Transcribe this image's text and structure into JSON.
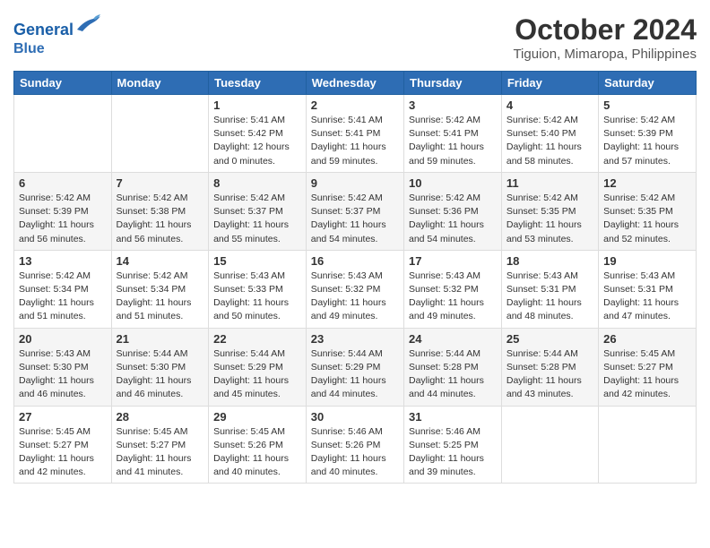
{
  "header": {
    "logo_line1": "General",
    "logo_line2": "Blue",
    "title": "October 2024",
    "subtitle": "Tiguion, Mimaropa, Philippines"
  },
  "weekdays": [
    "Sunday",
    "Monday",
    "Tuesday",
    "Wednesday",
    "Thursday",
    "Friday",
    "Saturday"
  ],
  "weeks": [
    [
      {
        "day": "",
        "info": ""
      },
      {
        "day": "",
        "info": ""
      },
      {
        "day": "1",
        "sunrise": "Sunrise: 5:41 AM",
        "sunset": "Sunset: 5:42 PM",
        "daylight": "Daylight: 12 hours and 0 minutes."
      },
      {
        "day": "2",
        "sunrise": "Sunrise: 5:41 AM",
        "sunset": "Sunset: 5:41 PM",
        "daylight": "Daylight: 11 hours and 59 minutes."
      },
      {
        "day": "3",
        "sunrise": "Sunrise: 5:42 AM",
        "sunset": "Sunset: 5:41 PM",
        "daylight": "Daylight: 11 hours and 59 minutes."
      },
      {
        "day": "4",
        "sunrise": "Sunrise: 5:42 AM",
        "sunset": "Sunset: 5:40 PM",
        "daylight": "Daylight: 11 hours and 58 minutes."
      },
      {
        "day": "5",
        "sunrise": "Sunrise: 5:42 AM",
        "sunset": "Sunset: 5:39 PM",
        "daylight": "Daylight: 11 hours and 57 minutes."
      }
    ],
    [
      {
        "day": "6",
        "sunrise": "Sunrise: 5:42 AM",
        "sunset": "Sunset: 5:39 PM",
        "daylight": "Daylight: 11 hours and 56 minutes."
      },
      {
        "day": "7",
        "sunrise": "Sunrise: 5:42 AM",
        "sunset": "Sunset: 5:38 PM",
        "daylight": "Daylight: 11 hours and 56 minutes."
      },
      {
        "day": "8",
        "sunrise": "Sunrise: 5:42 AM",
        "sunset": "Sunset: 5:37 PM",
        "daylight": "Daylight: 11 hours and 55 minutes."
      },
      {
        "day": "9",
        "sunrise": "Sunrise: 5:42 AM",
        "sunset": "Sunset: 5:37 PM",
        "daylight": "Daylight: 11 hours and 54 minutes."
      },
      {
        "day": "10",
        "sunrise": "Sunrise: 5:42 AM",
        "sunset": "Sunset: 5:36 PM",
        "daylight": "Daylight: 11 hours and 54 minutes."
      },
      {
        "day": "11",
        "sunrise": "Sunrise: 5:42 AM",
        "sunset": "Sunset: 5:35 PM",
        "daylight": "Daylight: 11 hours and 53 minutes."
      },
      {
        "day": "12",
        "sunrise": "Sunrise: 5:42 AM",
        "sunset": "Sunset: 5:35 PM",
        "daylight": "Daylight: 11 hours and 52 minutes."
      }
    ],
    [
      {
        "day": "13",
        "sunrise": "Sunrise: 5:42 AM",
        "sunset": "Sunset: 5:34 PM",
        "daylight": "Daylight: 11 hours and 51 minutes."
      },
      {
        "day": "14",
        "sunrise": "Sunrise: 5:42 AM",
        "sunset": "Sunset: 5:34 PM",
        "daylight": "Daylight: 11 hours and 51 minutes."
      },
      {
        "day": "15",
        "sunrise": "Sunrise: 5:43 AM",
        "sunset": "Sunset: 5:33 PM",
        "daylight": "Daylight: 11 hours and 50 minutes."
      },
      {
        "day": "16",
        "sunrise": "Sunrise: 5:43 AM",
        "sunset": "Sunset: 5:32 PM",
        "daylight": "Daylight: 11 hours and 49 minutes."
      },
      {
        "day": "17",
        "sunrise": "Sunrise: 5:43 AM",
        "sunset": "Sunset: 5:32 PM",
        "daylight": "Daylight: 11 hours and 49 minutes."
      },
      {
        "day": "18",
        "sunrise": "Sunrise: 5:43 AM",
        "sunset": "Sunset: 5:31 PM",
        "daylight": "Daylight: 11 hours and 48 minutes."
      },
      {
        "day": "19",
        "sunrise": "Sunrise: 5:43 AM",
        "sunset": "Sunset: 5:31 PM",
        "daylight": "Daylight: 11 hours and 47 minutes."
      }
    ],
    [
      {
        "day": "20",
        "sunrise": "Sunrise: 5:43 AM",
        "sunset": "Sunset: 5:30 PM",
        "daylight": "Daylight: 11 hours and 46 minutes."
      },
      {
        "day": "21",
        "sunrise": "Sunrise: 5:44 AM",
        "sunset": "Sunset: 5:30 PM",
        "daylight": "Daylight: 11 hours and 46 minutes."
      },
      {
        "day": "22",
        "sunrise": "Sunrise: 5:44 AM",
        "sunset": "Sunset: 5:29 PM",
        "daylight": "Daylight: 11 hours and 45 minutes."
      },
      {
        "day": "23",
        "sunrise": "Sunrise: 5:44 AM",
        "sunset": "Sunset: 5:29 PM",
        "daylight": "Daylight: 11 hours and 44 minutes."
      },
      {
        "day": "24",
        "sunrise": "Sunrise: 5:44 AM",
        "sunset": "Sunset: 5:28 PM",
        "daylight": "Daylight: 11 hours and 44 minutes."
      },
      {
        "day": "25",
        "sunrise": "Sunrise: 5:44 AM",
        "sunset": "Sunset: 5:28 PM",
        "daylight": "Daylight: 11 hours and 43 minutes."
      },
      {
        "day": "26",
        "sunrise": "Sunrise: 5:45 AM",
        "sunset": "Sunset: 5:27 PM",
        "daylight": "Daylight: 11 hours and 42 minutes."
      }
    ],
    [
      {
        "day": "27",
        "sunrise": "Sunrise: 5:45 AM",
        "sunset": "Sunset: 5:27 PM",
        "daylight": "Daylight: 11 hours and 42 minutes."
      },
      {
        "day": "28",
        "sunrise": "Sunrise: 5:45 AM",
        "sunset": "Sunset: 5:27 PM",
        "daylight": "Daylight: 11 hours and 41 minutes."
      },
      {
        "day": "29",
        "sunrise": "Sunrise: 5:45 AM",
        "sunset": "Sunset: 5:26 PM",
        "daylight": "Daylight: 11 hours and 40 minutes."
      },
      {
        "day": "30",
        "sunrise": "Sunrise: 5:46 AM",
        "sunset": "Sunset: 5:26 PM",
        "daylight": "Daylight: 11 hours and 40 minutes."
      },
      {
        "day": "31",
        "sunrise": "Sunrise: 5:46 AM",
        "sunset": "Sunset: 5:25 PM",
        "daylight": "Daylight: 11 hours and 39 minutes."
      },
      {
        "day": "",
        "info": ""
      },
      {
        "day": "",
        "info": ""
      }
    ]
  ]
}
